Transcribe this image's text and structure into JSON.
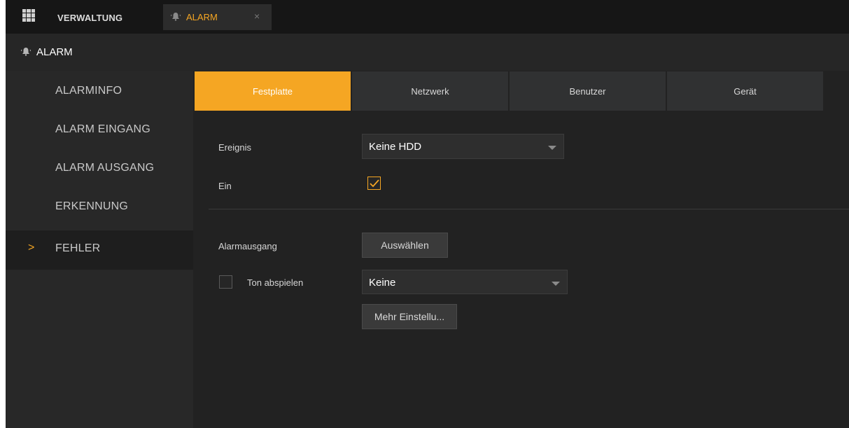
{
  "topbar": {
    "title": "VERWALTUNG",
    "tab": {
      "label": "ALARM",
      "icon": "bell-icon"
    }
  },
  "section": {
    "title": "ALARM",
    "icon": "bell-icon"
  },
  "sidebar": {
    "items": [
      {
        "label": "ALARMINFO",
        "active": false
      },
      {
        "label": "ALARM EINGANG",
        "active": false
      },
      {
        "label": "ALARM AUSGANG",
        "active": false
      },
      {
        "label": "ERKENNUNG",
        "active": false
      },
      {
        "label": "FEHLER",
        "active": true
      }
    ],
    "active_marker": ">"
  },
  "tabs": [
    {
      "label": "Festplatte",
      "active": true
    },
    {
      "label": "Netzwerk",
      "active": false
    },
    {
      "label": "Benutzer",
      "active": false
    },
    {
      "label": "Gerät",
      "active": false
    }
  ],
  "form": {
    "event_label": "Ereignis",
    "event_value": "Keine HDD",
    "enable_label": "Ein",
    "enable_checked": true,
    "alarm_output_label": "Alarmausgang",
    "select_button": "Auswählen",
    "play_sound_label": "Ton abspielen",
    "play_sound_checked": false,
    "sound_value": "Keine",
    "more_settings_button": "Mehr Einstellu..."
  },
  "colors": {
    "accent": "#f5a623",
    "background": "#1f1f1f",
    "sidebar": "#282828",
    "tab": "#303132"
  }
}
